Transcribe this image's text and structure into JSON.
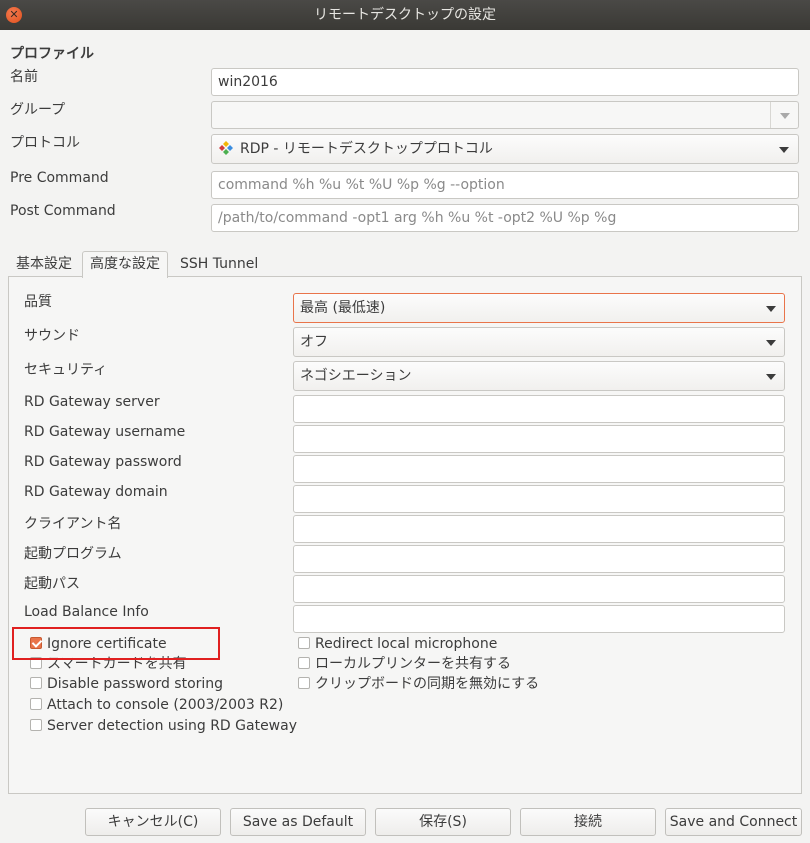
{
  "window": {
    "title": "リモートデスクトップの設定"
  },
  "profile": {
    "section_label": "プロファイル",
    "name_label": "名前",
    "name_value": "win2016",
    "group_label": "グループ",
    "group_value": "",
    "protocol_label": "プロトコル",
    "protocol_value": "RDP - リモートデスクトッププロトコル",
    "pre_command_label": "Pre Command",
    "pre_command_placeholder": "command %h %u %t %U %p %g --option",
    "post_command_label": "Post Command",
    "post_command_placeholder": "/path/to/command -opt1 arg %h %u %t -opt2 %U %p %g"
  },
  "tabs": [
    {
      "label": "基本設定",
      "active": false
    },
    {
      "label": "高度な設定",
      "active": true
    },
    {
      "label": "SSH Tunnel",
      "active": false
    }
  ],
  "advanced": {
    "quality_label": "品質",
    "quality_value": "最高 (最低速)",
    "sound_label": "サウンド",
    "sound_value": "オフ",
    "security_label": "セキュリティ",
    "security_value": "ネゴシエーション",
    "gw_server_label": "RD Gateway server",
    "gw_username_label": "RD Gateway username",
    "gw_password_label": "RD Gateway password",
    "gw_domain_label": "RD Gateway domain",
    "client_name_label": "クライアント名",
    "startup_program_label": "起動プログラム",
    "startup_path_label": "起動パス",
    "load_balance_label": "Load Balance Info"
  },
  "checkboxes": {
    "ignore_certificate": {
      "label": "Ignore certificate",
      "checked": true
    },
    "share_smartcard": {
      "label": "スマートカードを共有",
      "checked": false
    },
    "disable_password_storing": {
      "label": "Disable password storing",
      "checked": false
    },
    "attach_console": {
      "label": "Attach to console (2003/2003 R2)",
      "checked": false
    },
    "server_detection": {
      "label": "Server detection using RD Gateway",
      "checked": false
    },
    "redirect_microphone": {
      "label": "Redirect local microphone",
      "checked": false
    },
    "share_printer": {
      "label": "ローカルプリンターを共有する",
      "checked": false
    },
    "disable_clipboard_sync": {
      "label": "クリップボードの同期を無効にする",
      "checked": false
    }
  },
  "buttons": {
    "cancel": "キャンセル(C)",
    "save_default": "Save as Default",
    "save": "保存(S)",
    "connect": "接続",
    "save_connect": "Save and Connect"
  },
  "colors": {
    "accent": "#e9744a",
    "highlight": "#e02020",
    "titlebar": "#3d3c39"
  },
  "icons": {
    "close": "close-icon",
    "protocol": "rdp-plugin-icon",
    "dropdown": "chevron-down-icon"
  }
}
